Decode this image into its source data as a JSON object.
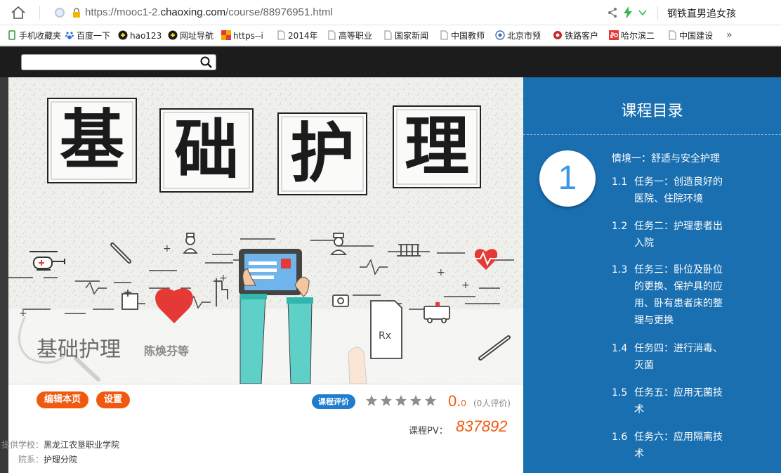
{
  "browser": {
    "url_prefix": "https://mooc1-2.",
    "url_domain": "chaoxing.com",
    "url_suffix": "/course/88976951.html",
    "user": "钢铁直男追女孩"
  },
  "bookmarks": [
    "手机收藏夹",
    "百度一下",
    "hao123",
    "网址导航",
    "https--i",
    "2014年",
    "高等职业",
    "国家新闻",
    "中国教师",
    "北京市预",
    "铁路客户",
    "哈尔滨二",
    "中国建设"
  ],
  "bookmarks_more": "»",
  "search": {
    "placeholder": ""
  },
  "banner": {
    "title": "基础护理",
    "teacher": "陈焕芬等",
    "headline_chars": [
      "基",
      "础",
      "护",
      "理"
    ]
  },
  "actions": {
    "edit": "编辑本页",
    "settings": "设置"
  },
  "rating": {
    "button": "课程评价",
    "stars": 0,
    "score_main": "0.",
    "score_dec": "0",
    "count": "(0人评价)"
  },
  "pv": {
    "label": "课程PV：",
    "value": "837892"
  },
  "meta": [
    {
      "key": "提供学校：",
      "value": "黑龙江农垦职业学院"
    },
    {
      "key": "院系：",
      "value": "护理分院"
    }
  ],
  "sidebar": {
    "title": "课程目录",
    "chapter_num": "1",
    "chapter_title": "情境一：舒适与安全护理",
    "tasks": [
      {
        "num": "1.1",
        "lines": [
          "任务一：创造良好的",
          "医院、住院环境"
        ]
      },
      {
        "num": "1.2",
        "lines": [
          "任务二：护理患者出",
          "入院"
        ]
      },
      {
        "num": "1.3",
        "lines": [
          "任务三：卧位及卧位",
          "的更换、保护具的应",
          "用、卧有患者床的整",
          "理与更换"
        ]
      },
      {
        "num": "1.4",
        "lines": [
          "任务四：进行消毒、",
          "灭菌"
        ]
      },
      {
        "num": "1.5",
        "lines": [
          "任务五：应用无菌技",
          "术"
        ]
      },
      {
        "num": "1.6",
        "lines": [
          "任务六：应用隔离技",
          "术"
        ]
      }
    ]
  },
  "colors": {
    "accent_orange": "#f05a10",
    "sidebar_blue": "#1a6fb0",
    "rate_blue": "#1f7ccf",
    "heart_red": "#e53935"
  }
}
